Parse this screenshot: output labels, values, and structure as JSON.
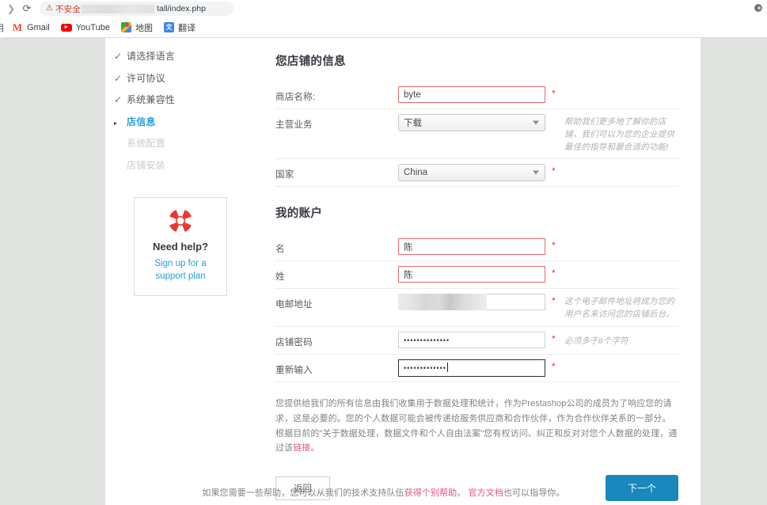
{
  "browser": {
    "nav_forward_icon": "forward-arrow-icon",
    "reload_icon": "reload-icon",
    "security_icon": "warning-triangle-icon",
    "security_label": "不安全",
    "url_visible_text": "tall/index.php",
    "profile_icon": "profile-avatar-icon",
    "bookmarks": [
      {
        "label": "用",
        "icon": "partial-bookmark-icon"
      },
      {
        "label": "Gmail",
        "icon": "gmail-icon"
      },
      {
        "label": "YouTube",
        "icon": "youtube-icon"
      },
      {
        "label": "地图",
        "icon": "google-maps-icon"
      },
      {
        "label": "翻译",
        "icon": "google-translate-icon"
      }
    ]
  },
  "sidebar": {
    "steps": [
      {
        "label": "请选择语言",
        "state": "done",
        "mark": "✓"
      },
      {
        "label": "许可协议",
        "state": "done",
        "mark": "✓"
      },
      {
        "label": "系统兼容性",
        "state": "done",
        "mark": "✓"
      },
      {
        "label": "店信息",
        "state": "current",
        "mark": "▸"
      },
      {
        "label": "系统配置",
        "state": "todo",
        "mark": ""
      },
      {
        "label": "店铺安装",
        "state": "todo",
        "mark": ""
      }
    ],
    "help": {
      "icon": "lifebuoy-icon",
      "title": "Need help?",
      "link_line1": "Sign up for a",
      "link_line2": "support plan"
    }
  },
  "form": {
    "shop_section_title": "您店铺的信息",
    "account_section_title": "我的账户",
    "fields": {
      "shop_name": {
        "label": "商店名称:",
        "value": "byte",
        "required_mark": "*"
      },
      "main_activity": {
        "label": "主营业务",
        "value": "下载",
        "hint": "帮助我们更多地了解你的店铺，我们可以为您的企业提供最佳的指导和最合适的功能!",
        "caret_icon": "chevron-down-icon"
      },
      "country": {
        "label": "国家",
        "value": "China",
        "required_mark": "*",
        "caret_icon": "chevron-down-icon"
      },
      "first_name": {
        "label": "名",
        "value": "陈",
        "required_mark": "*"
      },
      "last_name": {
        "label": "姓",
        "value": "陈",
        "required_mark": "*"
      },
      "email": {
        "label": "电邮地址",
        "value": "",
        "redacted": true,
        "required_mark": "*",
        "hint": "这个电子邮件地址将成为您的用户名来访问您的店铺后台。"
      },
      "password": {
        "label": "店铺密码",
        "value": "••••••••••••••",
        "required_mark": "*",
        "hint": "必须多于8个字符"
      },
      "password_confirm": {
        "label": "重新输入",
        "value": "•••••••••••••",
        "required_mark": "*",
        "focused": true
      }
    },
    "privacy_text_1": "您提供给我们的所有信息由我们收集用于数据处理和统计，作为Prestashop公司的成员为了响应您的请求，这是必要的。您的个人数据可能会被传递给服务供应商和合作伙伴，作为合作伙伴关系的一部分。根据目前的\"关于数据处理，数据文件和个人自由法案\"您有权访问、纠正和反对对您个人数据的处理，通过该",
    "privacy_link": "链接",
    "privacy_text_2": "。",
    "buttons": {
      "back": "返回",
      "next": "下一个"
    }
  },
  "footer": {
    "text_1": "如果您需要一些帮助，您可以从我们的技术支持队伍",
    "link_1": "获得个别帮助",
    "text_2": "。 ",
    "link_2": "官方文档",
    "text_3": "也可以指导你。"
  },
  "colors": {
    "accent_blue": "#1a87bd",
    "step_current": "#25a0d8",
    "check_green": "#3a9a3a",
    "required_red": "#e8392f",
    "link_pink": "#e2557f",
    "insecure_red": "#d93025"
  }
}
